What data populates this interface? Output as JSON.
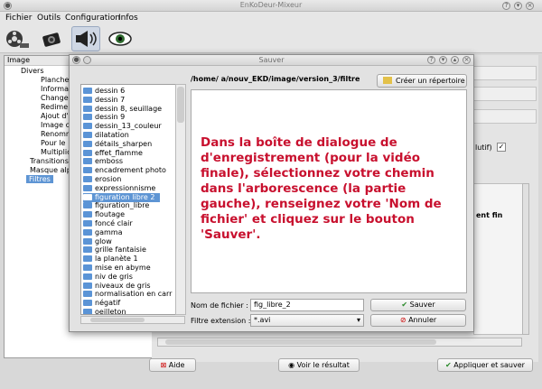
{
  "window": {
    "title": "EnKoDeur-Mixeur"
  },
  "menu": [
    "Fichier",
    "Outils",
    "Configuration",
    "Infos"
  ],
  "toolbar": {
    "icons": [
      "film-reel-icon",
      "camera-icon",
      "music-speaker-icon",
      "eye-icon"
    ]
  },
  "left_panel": {
    "header": "Image",
    "tree": [
      "Divers",
      "Planche",
      "Informa",
      "Change",
      "Redime",
      "Ajout d'",
      "Image c",
      "Renomm",
      "Pour le",
      "Multiplic",
      "Transitions",
      "Masque alp",
      "Filtres"
    ]
  },
  "right_panel": {
    "checkbox_label": "lutif)",
    "side_text": "ent fin"
  },
  "bottom_buttons": {
    "help": "Aide",
    "view": "Voir le résultat",
    "apply": "Appliquer et sauver"
  },
  "dialog": {
    "title": "Sauver",
    "path": "/home/         a/nouv_EKD/image/version_3/filtre",
    "create_dir": "Créer un répertoire",
    "folders": [
      "dessin 6",
      "dessin 7",
      "dessin 8, seuillage",
      "dessin 9",
      "dessin_13_couleur",
      "dilatation",
      "détails_sharpen",
      "effet_flamme",
      "emboss",
      "encadrement photo",
      "erosion",
      "expressionnisme",
      "figuration libre 2",
      "figuration_libre",
      "floutage",
      "foncé clair",
      "gamma",
      "glow",
      "grille fantaisie",
      "la planète 1",
      "mise en abyme",
      "niv de gris",
      "niveaux de gris",
      "normalisation en carr",
      "négatif",
      "oeilleton"
    ],
    "selected_folder": "figuration libre 2",
    "message": "Dans la boîte de dialogue de d'enregistrement (pour la vidéo finale), sélectionnez votre chemin dans l'arborescence (la partie gauche), renseignez votre 'Nom de fichier' et cliquez sur le bouton 'Sauver'.",
    "filename_label": "Nom de fichier :",
    "filename_value": "fig_libre_2",
    "filter_label": "Filtre extension :",
    "filter_value": "*.avi",
    "save_label": "Sauver",
    "cancel_label": "Annuler"
  },
  "colors": {
    "accent": "#5e95d4",
    "message": "#c8102e"
  }
}
